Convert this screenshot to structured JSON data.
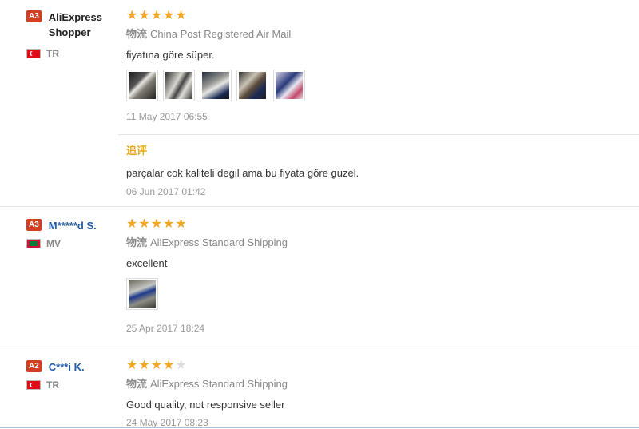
{
  "reviews": [
    {
      "level": "A3",
      "username": "AliExpress Shopper",
      "country": "TR",
      "rating": 5,
      "stars": "★★★★★",
      "stars_off": "",
      "shipping_label": "物流",
      "shipping": "China Post Registered Air Mail",
      "text": "fiyatına göre süper.",
      "photos": [
        "photo-1",
        "photo-2",
        "photo-3",
        "photo-4",
        "photo-5"
      ],
      "date": "11 May 2017 06:55",
      "followup": {
        "label": "追评",
        "text": "parçalar cok kaliteli degil ama bu fiyata göre guzel.",
        "date": "06 Jun 2017 01:42"
      }
    },
    {
      "level": "A3",
      "username": "M*****d S.",
      "country": "MV",
      "rating": 5,
      "stars": "★★★★★",
      "stars_off": "",
      "shipping_label": "物流",
      "shipping": "AliExpress Standard Shipping",
      "text": "excellent",
      "photos": [
        "photo-1"
      ],
      "date": "25 Apr 2017 18:24"
    },
    {
      "level": "A2",
      "username": "C***i K.",
      "country": "TR",
      "rating": 4,
      "stars": "★★★★",
      "stars_off": "★",
      "shipping_label": "物流",
      "shipping": "AliExpress Standard Shipping",
      "text": "Good quality, not responsive seller",
      "date": "24 May 2017 08:23"
    }
  ],
  "colors": {
    "level_badge": "#d23f22",
    "star": "#f5a623",
    "followup_label": "#e3a81b",
    "username_link": "#1f5aa6"
  }
}
